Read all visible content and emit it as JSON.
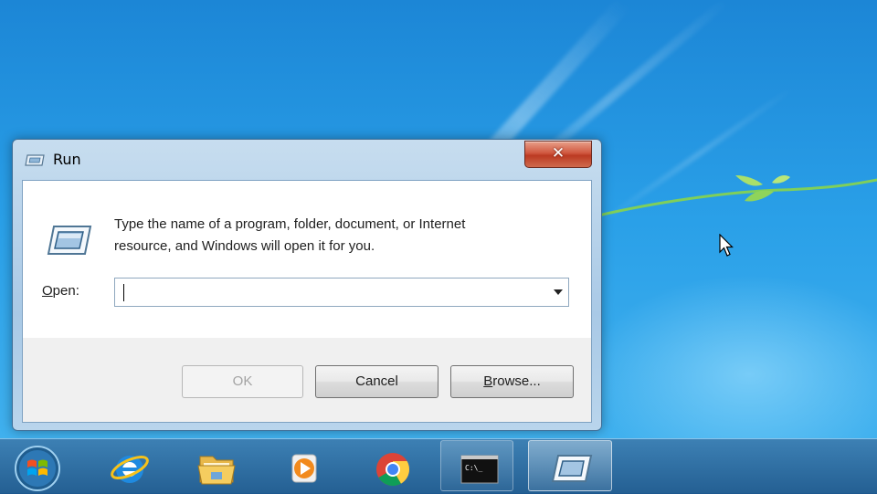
{
  "dialog": {
    "title": "Run",
    "description_line1": "Type the name of a program, folder, document, or Internet",
    "description_line2": "resource, and Windows will open it for you.",
    "open_label_underlined": "O",
    "open_label_rest": "pen:",
    "open_value": "",
    "ok_label": "OK",
    "cancel_label": "Cancel",
    "browse_label_underlined": "B",
    "browse_label_rest": "rowse...",
    "close_symbol": "✕"
  },
  "taskbar": {
    "items": [
      {
        "icon": "start-orb-icon"
      },
      {
        "icon": "internet-explorer-icon"
      },
      {
        "icon": "file-explorer-icon"
      },
      {
        "icon": "media-player-icon"
      },
      {
        "icon": "chrome-icon"
      },
      {
        "icon": "command-prompt-icon",
        "text": "C:\\_"
      },
      {
        "icon": "run-icon"
      }
    ]
  },
  "colors": {
    "desktop": "#2aa0e8",
    "close_button": "#c9462c"
  }
}
